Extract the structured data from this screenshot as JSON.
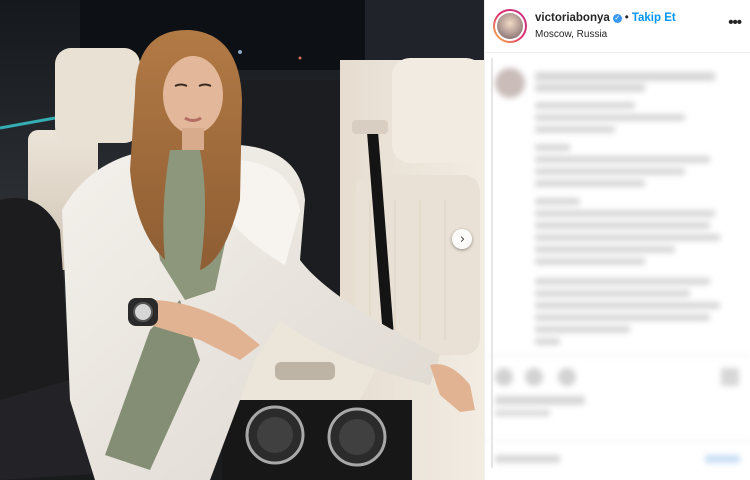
{
  "post": {
    "username": "victoriabonya",
    "verified_mark": "✓",
    "separator": "•",
    "follow_label": "Takip Et",
    "location": "Moscow, Russia",
    "more_label": "•••",
    "next_label": "›"
  },
  "icons": {
    "verified": "verified-badge-icon",
    "more": "more-options-icon",
    "next": "chevron-right-icon"
  },
  "colors": {
    "accent": "#0095f6",
    "verified": "#3897f0",
    "text": "#262626",
    "ambient_light": "#39d0d6"
  }
}
